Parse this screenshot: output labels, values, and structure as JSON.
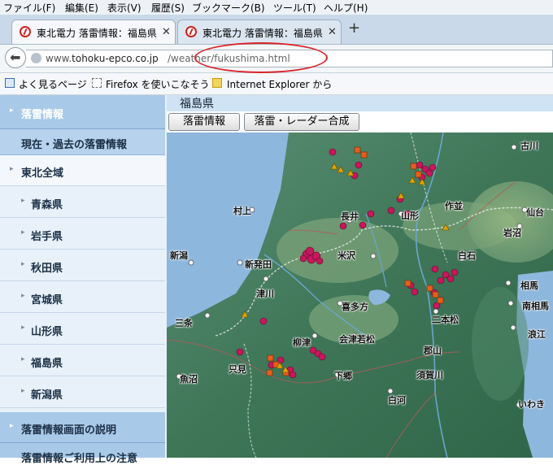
{
  "menu": [
    "ファイル(F)",
    "編集(E)",
    "表示(V)",
    "履歴(S)",
    "ブックマーク(B)",
    "ツール(T)",
    "ヘルプ(H)"
  ],
  "tabs": [
    {
      "title": "東北電力 落雷情報：福島県",
      "active": true
    },
    {
      "title": "東北電力 落雷情報：福島県",
      "active": false
    }
  ],
  "url": {
    "host_prefix": "www.",
    "host": "tohoku-epco.co.jp",
    "path": "/weather/fukushima.html"
  },
  "bookmarks": [
    "よく見るページ",
    "Firefox を使いこなそう",
    "Internet Explorer から"
  ],
  "sidebar": {
    "section_title": "落雷情報",
    "subsection": "現在・過去の落雷情報",
    "items": [
      "東北全域",
      "青森県",
      "岩手県",
      "秋田県",
      "宮城県",
      "山形県",
      "福島県",
      "新潟県"
    ],
    "footer1": "落雷情報画面の説明",
    "footer2": "落雷情報ご利用上の注意"
  },
  "content": {
    "prefecture_title": "福島県",
    "buttons": [
      "落雷情報",
      "落雷・レーダー合成"
    ]
  },
  "map": {
    "cities": [
      "古川",
      "仙台",
      "岩沼",
      "作並",
      "村上",
      "長井",
      "山形",
      "白石",
      "新潟",
      "新発田",
      "米沢",
      "津川",
      "相馬",
      "南相馬",
      "三条",
      "喜多方",
      "二本松",
      "浪江",
      "柳津",
      "会津若松",
      "郡山",
      "魚沼",
      "只見",
      "下郷",
      "須賀川",
      "白河",
      "いわき"
    ],
    "colors": {
      "strike_recent": "#c8175c",
      "strike_older": "#e85d1d",
      "strike_triangle": "#e2a300"
    }
  }
}
